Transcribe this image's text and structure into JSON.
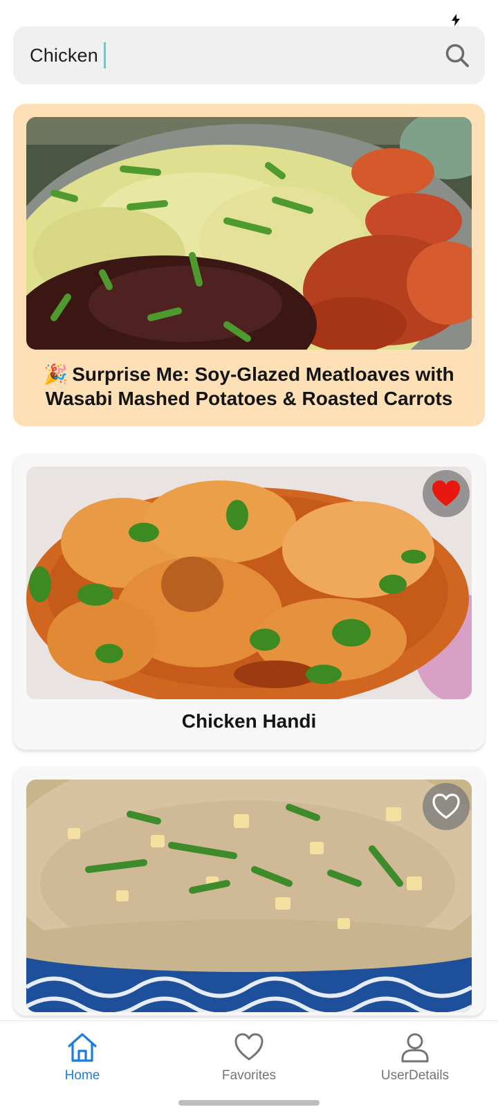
{
  "search": {
    "value": "Chicken"
  },
  "featured": {
    "emoji": "🎉",
    "title": "Surprise Me: Soy-Glazed Meatloaves with Wasabi Mashed Potatoes & Roasted Carrots",
    "accent_color": "#fde0b6"
  },
  "recipes": [
    {
      "title": "Chicken Handi",
      "favorited": true
    },
    {
      "title": "",
      "favorited": false
    }
  ],
  "nav": {
    "active_color": "#1c7ed8",
    "items": [
      {
        "label": "Home",
        "icon": "home-icon",
        "active": true
      },
      {
        "label": "Favorites",
        "icon": "heart-outline-icon",
        "active": false
      },
      {
        "label": "UserDetails",
        "icon": "user-icon",
        "active": false
      }
    ]
  }
}
